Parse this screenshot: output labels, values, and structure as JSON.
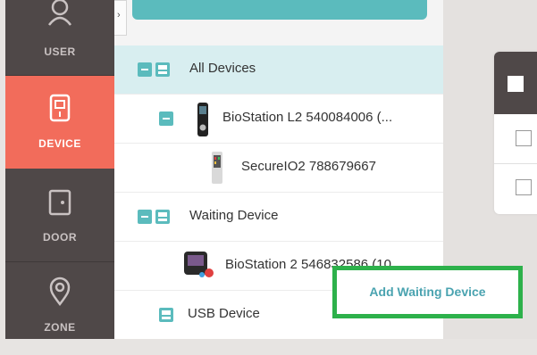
{
  "nav": {
    "items": [
      {
        "label": "USER",
        "icon": "user-icon"
      },
      {
        "label": "DEVICE",
        "icon": "device-icon",
        "active": true
      },
      {
        "label": "DOOR",
        "icon": "door-icon"
      },
      {
        "label": "ZONE",
        "icon": "zone-icon"
      }
    ]
  },
  "collapse_glyph": "›",
  "tree": {
    "rows": [
      {
        "label": "All Devices"
      },
      {
        "label": "BioStation L2 540084006 (..."
      },
      {
        "label": "SecureIO2 788679667"
      },
      {
        "label": "Waiting Device"
      },
      {
        "label": "BioStation 2 546832586 (10"
      },
      {
        "label": "USB Device"
      }
    ]
  },
  "popup": {
    "label": "Add Waiting Device"
  },
  "colors": {
    "accent": "#5bbbbd",
    "active_nav": "#f26c5b",
    "nav_bg": "#4f4848",
    "highlight_border": "#2db14b",
    "selected_row": "#d8eef0"
  }
}
